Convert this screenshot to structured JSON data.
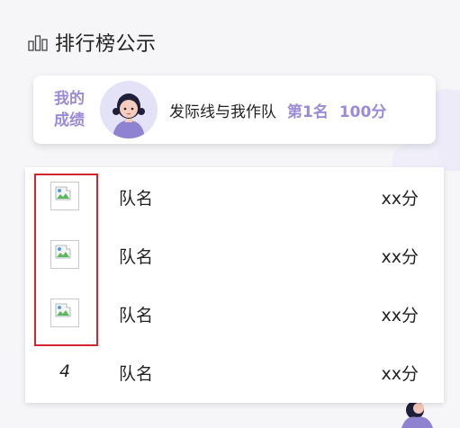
{
  "header": {
    "title": "排行榜公示",
    "icon": "bar-chart-icon"
  },
  "my_score": {
    "label": "我的\n成绩",
    "team_name": "发际线与我作队",
    "rank": "第1名",
    "score": "100分",
    "accent_color": "#9b8bd6"
  },
  "ranking_list": {
    "rows": [
      {
        "rank": "",
        "rank_image": "broken-image-icon",
        "name": "队名",
        "score": "xx分"
      },
      {
        "rank": "",
        "rank_image": "broken-image-icon",
        "name": "队名",
        "score": "xx分"
      },
      {
        "rank": "",
        "rank_image": "broken-image-icon",
        "name": "队名",
        "score": "xx分"
      },
      {
        "rank": "4",
        "rank_image": "",
        "name": "队名",
        "score": "xx分"
      }
    ]
  },
  "highlight_color": "#d0262c"
}
